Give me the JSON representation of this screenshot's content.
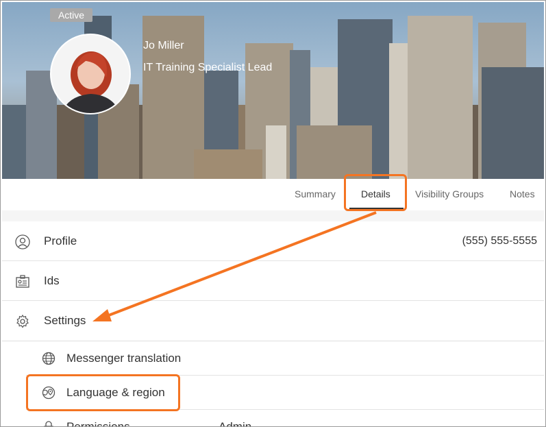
{
  "header": {
    "status_badge": "Active",
    "name": "Jo Miller",
    "title": "IT Training Specialist Lead"
  },
  "tabs": [
    {
      "label": "Summary"
    },
    {
      "label": "Details",
      "active": true
    },
    {
      "label": "Visibility Groups"
    },
    {
      "label": "Notes"
    }
  ],
  "sections": [
    {
      "label": "Profile",
      "value": "(555) 555-5555",
      "icon": "person-circle-icon"
    },
    {
      "label": "Ids",
      "icon": "id-card-icon"
    },
    {
      "label": "Settings",
      "icon": "gear-icon"
    }
  ],
  "settings_items": [
    {
      "label": "Messenger translation",
      "icon": "globe-icon"
    },
    {
      "label": "Language & region",
      "icon": "globe-pin-icon"
    },
    {
      "label": "Permissions",
      "value": "Admin",
      "icon": "lock-icon"
    }
  ],
  "colors": {
    "highlight": "#f47422",
    "text": "#333333",
    "tab_inactive": "#666666"
  }
}
